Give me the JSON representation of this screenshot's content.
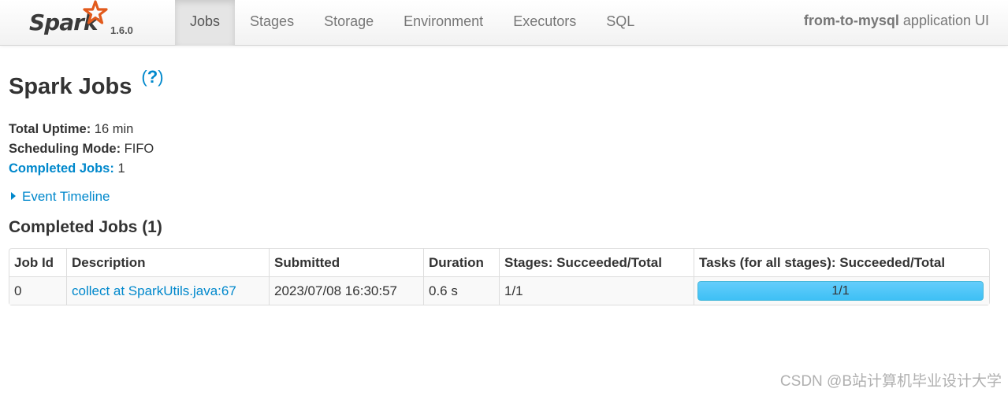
{
  "brand": {
    "logo_text": "Spark",
    "version": "1.6.0"
  },
  "nav": {
    "tabs": [
      {
        "label": "Jobs",
        "active": true
      },
      {
        "label": "Stages",
        "active": false
      },
      {
        "label": "Storage",
        "active": false
      },
      {
        "label": "Environment",
        "active": false
      },
      {
        "label": "Executors",
        "active": false
      },
      {
        "label": "SQL",
        "active": false
      }
    ],
    "app_name": "from-to-mysql",
    "app_suffix": " application UI"
  },
  "page": {
    "title": "Spark Jobs",
    "help_open": "(",
    "help_q": "?",
    "help_close": ")"
  },
  "summary": {
    "uptime_label": "Total Uptime:",
    "uptime_value": " 16 min",
    "mode_label": "Scheduling Mode:",
    "mode_value": " FIFO",
    "completed_label": "Completed Jobs:",
    "completed_value": " 1"
  },
  "timeline": {
    "label": "Event Timeline"
  },
  "completed_section": {
    "title": "Completed Jobs (1)"
  },
  "table": {
    "headers": [
      "Job Id",
      "Description",
      "Submitted",
      "Duration",
      "Stages: Succeeded/Total",
      "Tasks (for all stages): Succeeded/Total"
    ],
    "rows": [
      {
        "job_id": "0",
        "description": "collect at SparkUtils.java:67",
        "submitted": "2023/07/08 16:30:57",
        "duration": "0.6 s",
        "stages": "1/1",
        "tasks": "1/1",
        "tasks_progress": 1.0
      }
    ]
  },
  "colors": {
    "link": "#0088cc",
    "progress_bar": "#4ec3f7"
  },
  "watermark": "CSDN @B站计算机毕业设计大学"
}
